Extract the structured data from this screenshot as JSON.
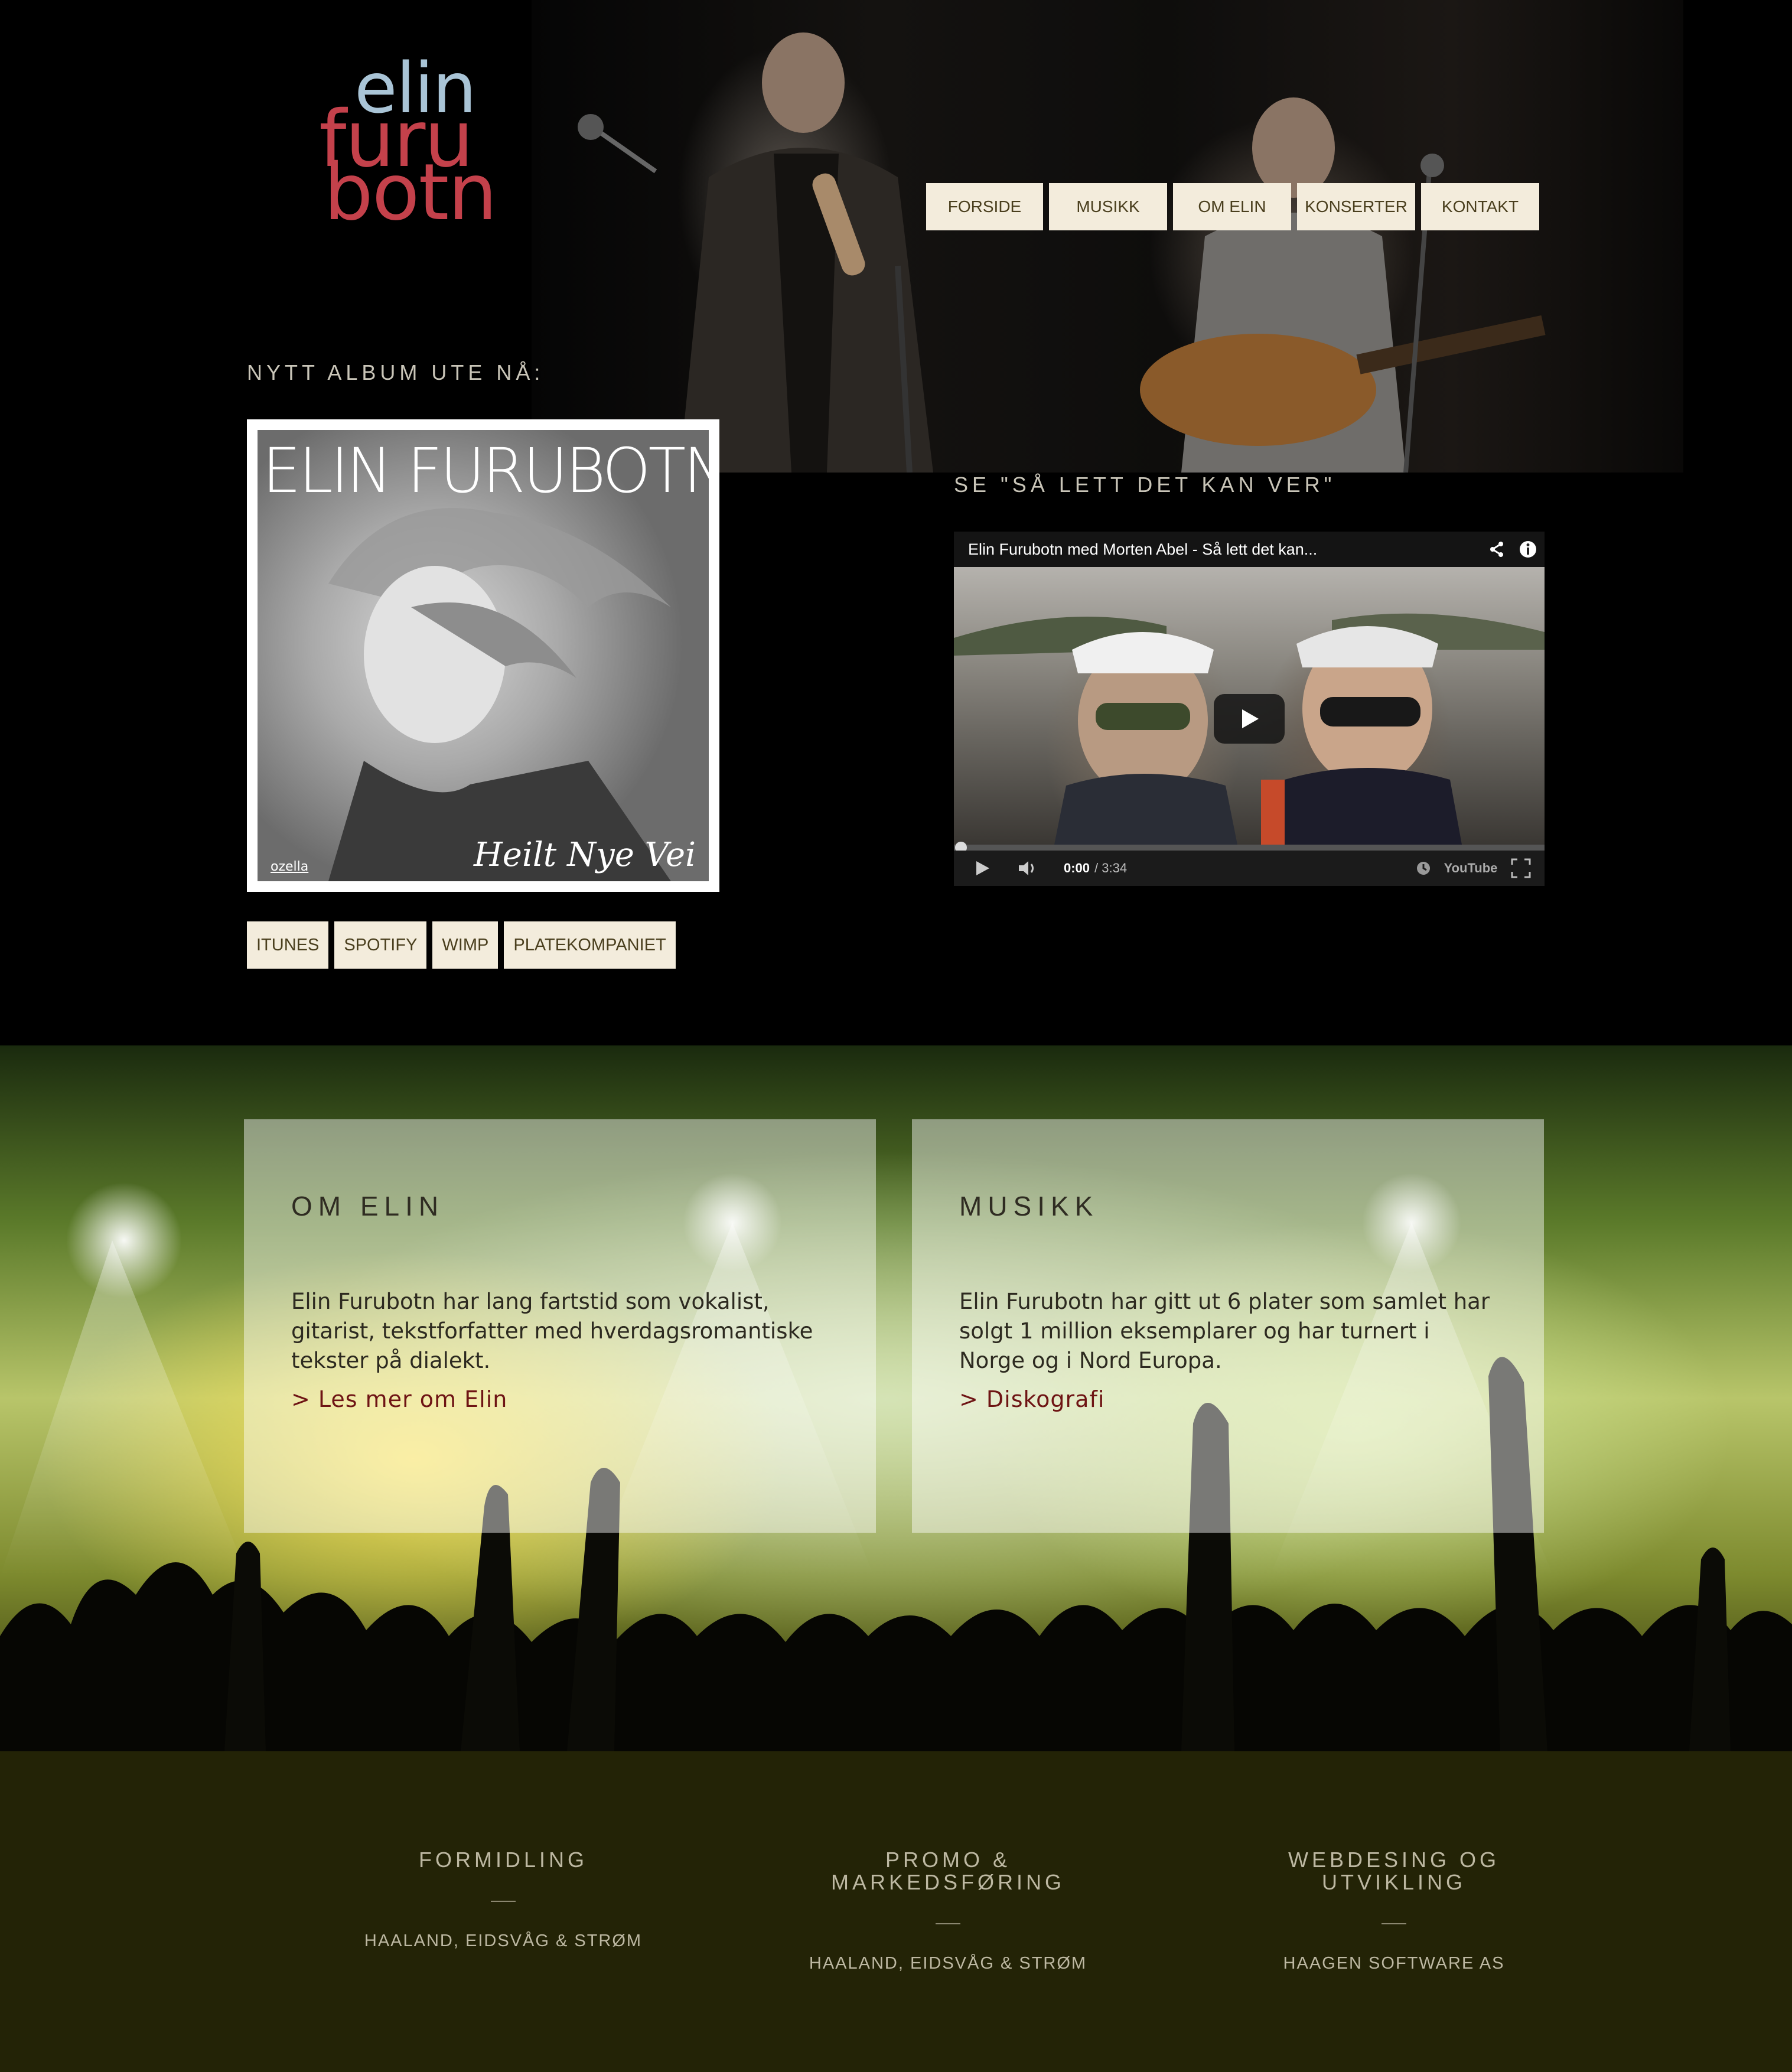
{
  "logo": {
    "line1": "elin",
    "line2": "furu",
    "line3": "botn"
  },
  "nav": {
    "items": [
      {
        "label": "FORSIDE"
      },
      {
        "label": "MUSIKK"
      },
      {
        "label": "OM ELIN"
      },
      {
        "label": "KONSERTER"
      },
      {
        "label": "KONTAKT"
      }
    ]
  },
  "album": {
    "heading": "NYTT ALBUM UTE NÅ:",
    "cover_title": "ELIN FURUBOTN",
    "cover_subtitle": "Heilt Nye Vei",
    "cover_label": "ozella",
    "stores": [
      {
        "label": "ITUNES"
      },
      {
        "label": "SPOTIFY"
      },
      {
        "label": "WIMP"
      },
      {
        "label": "PLATEKOMPANIET"
      }
    ]
  },
  "video": {
    "heading": "SE \"SÅ LETT DET KAN VER\"",
    "title": "Elin Furubotn med Morten Abel - Så lett det kan...",
    "time_current": "0:00",
    "time_total": "/ 3:34",
    "brand": "YouTube",
    "progress": 0.0
  },
  "features": {
    "om_elin": {
      "title": "OM ELIN",
      "text": "Elin Furubotn har lang fartstid som vokalist, gitarist, tekstforfatter med hverdagsromantiske tekster på dialekt.",
      "link": "> Les mer om Elin"
    },
    "musikk": {
      "title": "MUSIKK",
      "text": "Elin Furubotn har gitt ut 6 plater som samlet har solgt 1 million eksemplarer og har turnert i Norge og i Nord Europa.",
      "link": "> Diskografi"
    }
  },
  "footer": {
    "cols": [
      {
        "title": "FORMIDLING",
        "sub": "HAALAND, EIDSVÅG & STRØM"
      },
      {
        "title": "PROMO &\nMARKEDSFØRING",
        "sub": "HAALAND, EIDSVÅG & STRØM"
      },
      {
        "title": "WEBDESING OG\nUTVIKLING",
        "sub": "HAAGEN SOFTWARE AS"
      }
    ]
  },
  "colors": {
    "nav_bg": "#f3ecdc",
    "nav_text": "#4a3f1e",
    "logo_blue": "#a9c4d6",
    "logo_red": "#c4414b",
    "link": "#6e1414",
    "footer_bg": "#232306"
  }
}
